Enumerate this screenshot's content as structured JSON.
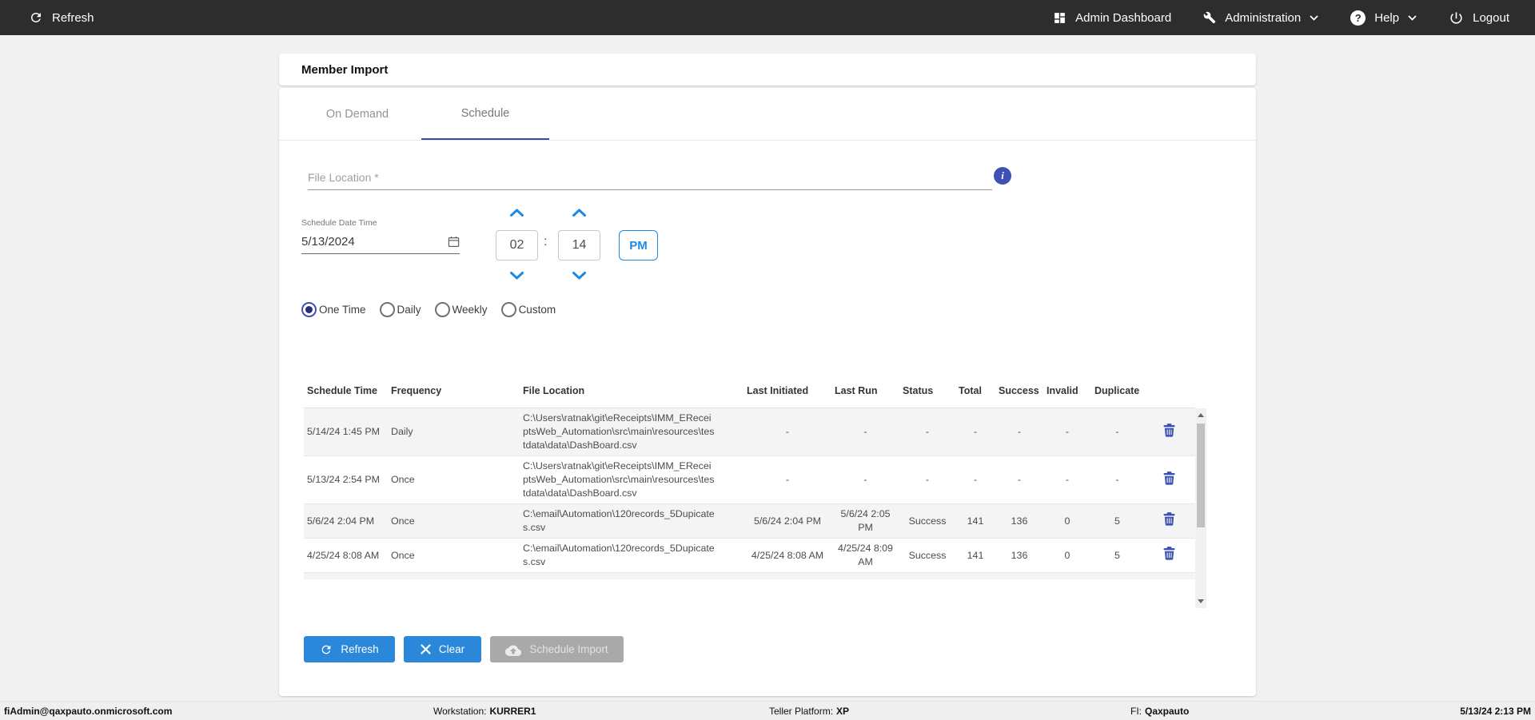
{
  "topbar": {
    "refresh": "Refresh",
    "admin_dashboard": "Admin Dashboard",
    "administration": "Administration",
    "help": "Help",
    "logout": "Logout"
  },
  "page": {
    "title": "Member Import"
  },
  "tabs": {
    "on_demand": "On Demand",
    "schedule": "Schedule",
    "active_tab": "Schedule"
  },
  "icons": {
    "info_glyph": "i",
    "help_glyph": "?"
  },
  "form": {
    "file_location_placeholder": "File Location *",
    "schedule_date_label": "Schedule Date Time",
    "schedule_date_value": "5/13/2024",
    "time_hour": "02",
    "time_separator": ":",
    "time_minute": "14",
    "meridiem": "PM",
    "frequency_options": [
      {
        "label": "One Time",
        "selected": true
      },
      {
        "label": "Daily",
        "selected": false
      },
      {
        "label": "Weekly",
        "selected": false
      },
      {
        "label": "Custom",
        "selected": false
      }
    ]
  },
  "table": {
    "headers": [
      "Schedule Time",
      "Frequency",
      "File Location",
      "Last Initiated",
      "Last Run",
      "Status",
      "Total",
      "Success",
      "Invalid",
      "Duplicate"
    ],
    "rows": [
      {
        "schedule_time": "5/14/24 1:45 PM",
        "frequency": "Daily",
        "file_location": "C:\\Users\\ratnak\\git\\eReceipts\\IMM_EReceiptsWeb_Automation\\src\\main\\resources\\testdata\\data\\DashBoard.csv",
        "last_initiated": "-",
        "last_run": "-",
        "status": "-",
        "total": "-",
        "success": "-",
        "invalid": "-",
        "duplicate": "-"
      },
      {
        "schedule_time": "5/13/24 2:54 PM",
        "frequency": "Once",
        "file_location": "C:\\Users\\ratnak\\git\\eReceipts\\IMM_EReceiptsWeb_Automation\\src\\main\\resources\\testdata\\data\\DashBoard.csv",
        "last_initiated": "-",
        "last_run": "-",
        "status": "-",
        "total": "-",
        "success": "-",
        "invalid": "-",
        "duplicate": "-"
      },
      {
        "schedule_time": "5/6/24 2:04 PM",
        "frequency": "Once",
        "file_location": "C:\\email\\Automation\\120records_5Dupicates.csv",
        "last_initiated": "5/6/24 2:04 PM",
        "last_run": "5/6/24 2:05 PM",
        "status": "Success",
        "total": "141",
        "success": "136",
        "invalid": "0",
        "duplicate": "5"
      },
      {
        "schedule_time": "4/25/24 8:08 AM",
        "frequency": "Once",
        "file_location": "C:\\email\\Automation\\120records_5Dupicates.csv",
        "last_initiated": "4/25/24 8:08 AM",
        "last_run": "4/25/24 8:09 AM",
        "status": "Success",
        "total": "141",
        "success": "136",
        "invalid": "0",
        "duplicate": "5"
      }
    ]
  },
  "actions": {
    "refresh": "Refresh",
    "clear": "Clear",
    "schedule_import": "Schedule Import"
  },
  "statusbar": {
    "user": "fiAdmin@qaxpauto.onmicrosoft.com",
    "workstation_label": "Workstation:",
    "workstation_value": "KURRER1",
    "teller_label": "Teller Platform:",
    "teller_value": "XP",
    "fi_label": "FI:",
    "fi_value": "Qaxpauto",
    "datetime": "5/13/24 2:13 PM"
  },
  "colors": {
    "topbar_bg": "#2d2d2d",
    "accent_button_blue": "#2b87da",
    "indigo": "#3f51b5",
    "tab_underline": "#3949ab",
    "control_blue": "#1e88e5",
    "disabled_gray": "#a9a9a9",
    "row_shaded": "#f4f4f4",
    "status_bg": "#efefef"
  }
}
